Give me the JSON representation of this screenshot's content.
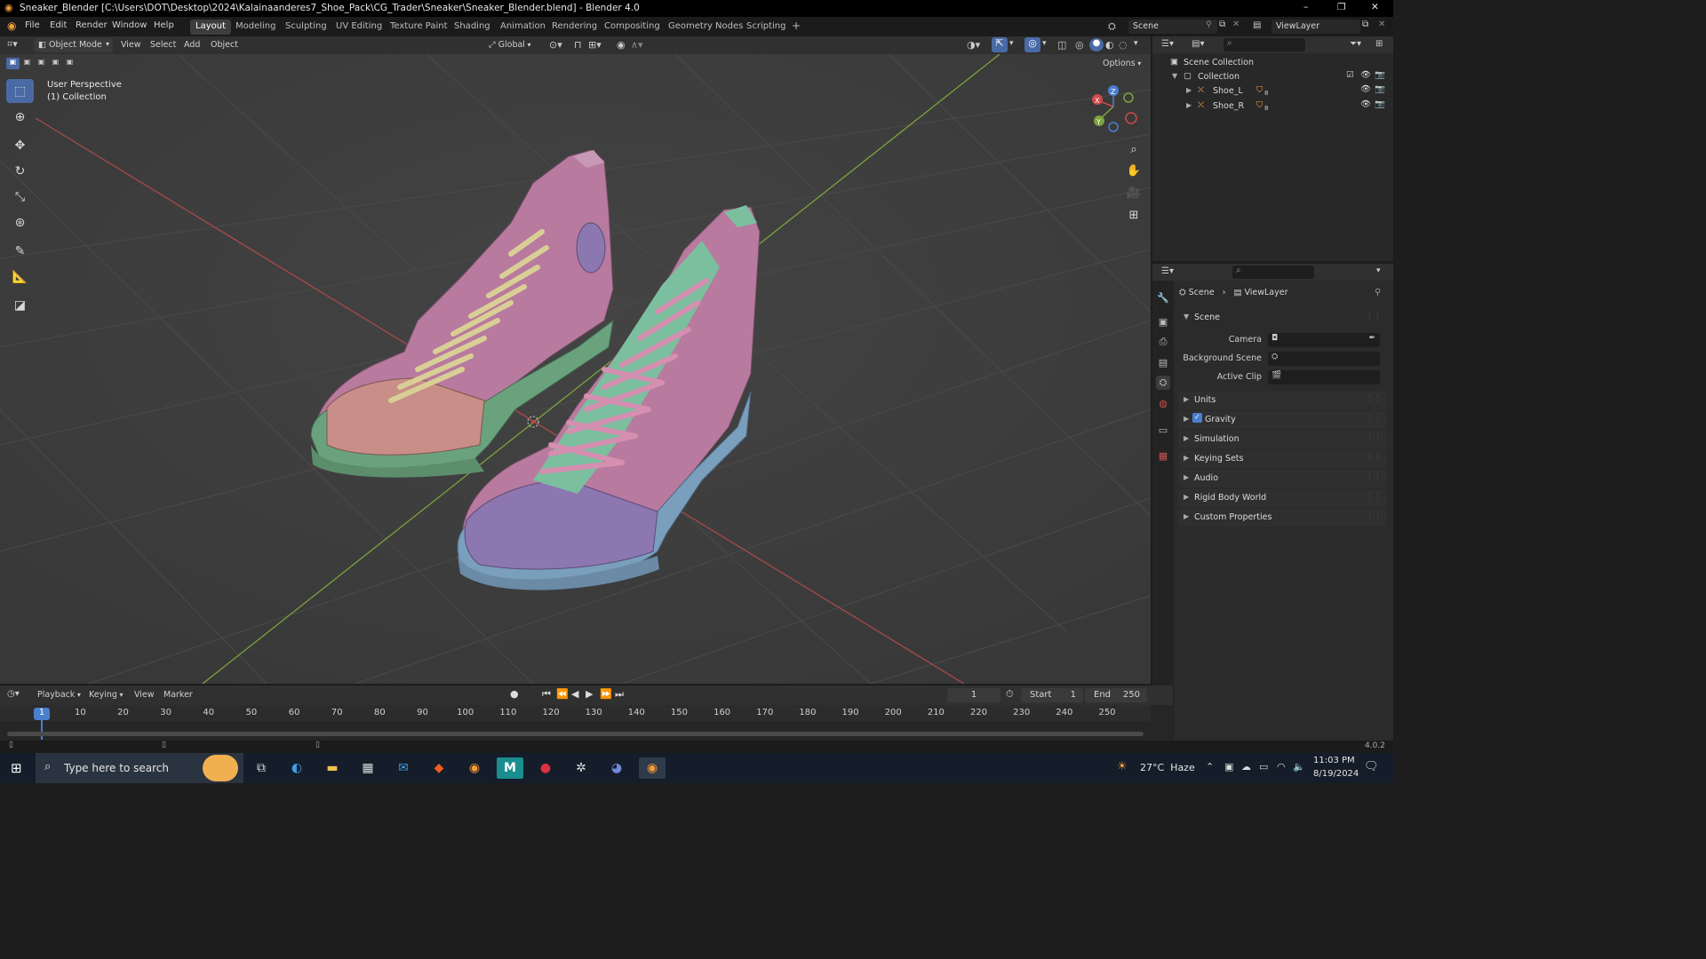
{
  "window": {
    "title": "Sneaker_Blender [C:\\Users\\DOT\\Desktop\\2024\\Kalainaanderes7_Shoe_Pack\\CG_Trader\\Sneaker\\Sneaker_Blender.blend] - Blender 4.0",
    "controls": [
      "–",
      "❐",
      "✕"
    ]
  },
  "menu": {
    "items": [
      "File",
      "Edit",
      "Render",
      "Window",
      "Help"
    ],
    "workspaces": [
      "Layout",
      "Modeling",
      "Sculpting",
      "UV Editing",
      "Texture Paint",
      "Shading",
      "Animation",
      "Rendering",
      "Compositing",
      "Geometry Nodes",
      "Scripting"
    ],
    "add_tab": "+",
    "scene": "Scene",
    "view_layer": "ViewLayer"
  },
  "viewport_header": {
    "mode": "Object Mode",
    "menus": [
      "View",
      "Select",
      "Add",
      "Object"
    ],
    "orientation": "Global",
    "options": "Options"
  },
  "viewport": {
    "perspective": "User Perspective",
    "collection": "(1) Collection",
    "gizmo_axes": [
      "X",
      "Y",
      "Z"
    ],
    "shoe_colors": {
      "upper": "#b87a9e",
      "sole_left": "#6aa27e",
      "sole_right": "#7a9fbd",
      "toe_left": "#c98e87",
      "toe_right": "#8c77b0",
      "laces_left": "#d9cf96",
      "laces_right": "#d58fb0",
      "tongue_right": "#7bbf9f"
    }
  },
  "outliner": {
    "root": "Scene Collection",
    "collection": "Collection",
    "objects": [
      {
        "name": "Shoe_L",
        "badge": "8"
      },
      {
        "name": "Shoe_R",
        "badge": "8"
      }
    ]
  },
  "properties": {
    "breadcrumb_scene": "Scene",
    "breadcrumb_layer": "ViewLayer",
    "section": "Scene",
    "fields": [
      {
        "label": "Camera",
        "value": ""
      },
      {
        "label": "Background Scene",
        "value": ""
      },
      {
        "label": "Active Clip",
        "value": ""
      }
    ],
    "panels": [
      "Units",
      "Gravity",
      "Simulation",
      "Keying Sets",
      "Audio",
      "Rigid Body World",
      "Custom Properties"
    ]
  },
  "timeline": {
    "menus": [
      "Playback",
      "Keying",
      "View",
      "Marker"
    ],
    "current_frame": "1",
    "start_label": "Start",
    "start": "1",
    "end_label": "End",
    "end": "250",
    "ticks": [
      "1",
      "10",
      "20",
      "30",
      "40",
      "50",
      "60",
      "70",
      "80",
      "90",
      "100",
      "110",
      "120",
      "130",
      "140",
      "150",
      "160",
      "170",
      "180",
      "190",
      "200",
      "210",
      "220",
      "230",
      "240",
      "250"
    ]
  },
  "status": {
    "version": "4.0.2"
  },
  "taskbar": {
    "search_placeholder": "Type here to search",
    "weather": "27°C  Haze",
    "time": "11:03 PM",
    "date": "8/19/2024"
  }
}
